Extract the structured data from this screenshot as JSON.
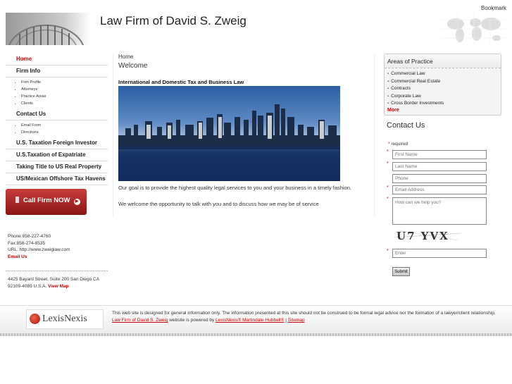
{
  "header": {
    "title": "Law Firm of David S. Zweig",
    "bookmark": "Bookmark"
  },
  "nav": {
    "home": "Home",
    "firm_info": "Firm Info",
    "firm_info_items": [
      "Firm Profile",
      "Attorneys",
      "Practice Areas",
      "Clients"
    ],
    "contact_us": "Contact Us",
    "contact_items": [
      "Email Form",
      "Directions"
    ],
    "taxation_foreign": "U.S. Taxation Foreign Investor",
    "taxation_expatriate": "U.S.Taxation of Expatriate",
    "taking_title": "Taking Title to US Real Property",
    "offshore": "US/Mexican Offshore Tax Havens"
  },
  "call_button": {
    "label": "Call Firm NOW"
  },
  "contact_info": {
    "phone": "Phone:858-227-4760",
    "fax": "Fax:858-274-8535",
    "url": "URL: http://www.zweiglaw.com",
    "email": "Email Us"
  },
  "address": {
    "text": "4425 Bayard Street, Suite 200 San Diego CA 92109-4089 U.S.A.",
    "view_map": "View Map"
  },
  "main": {
    "breadcrumb": "Home",
    "welcome": "Welcome",
    "heading": "International and Domestic Tax and Business Law",
    "para1": "Our goal is to provide the highest quality legal services to you and your business in a timely fashion.",
    "para2": "We welcome the opportunity to talk with you and to discuss how we may be of service"
  },
  "areas": {
    "title": "Areas of Practice",
    "items": [
      "Commercial Law",
      "Commercial Real Estate",
      "Contracts",
      "Corporate Law",
      "Cross Border Investments"
    ],
    "more": "More"
  },
  "contact_form": {
    "title": "Contact Us",
    "required_star": "*",
    "required_label": "required",
    "first_name": "First Name",
    "last_name": "Last Name",
    "phone": "Phone",
    "email": "Email Address",
    "message": "How can we help you?",
    "captcha_text": "U7 YVX",
    "enter": "Enter",
    "submit": "Submit"
  },
  "footer": {
    "logo": "LexisNexis",
    "text_main": "This web site is designed for general information only. The information presented at this site should not be construed to be formal legal advice nor the formation of a lawyer/client relationship.",
    "link_firm": "Law Firm of David S. Zweig",
    "text_mid": "website is powered by",
    "link_lexis": "LexisNexis® Martindale-Hubbell®",
    "separator": "|",
    "link_sitemap": "Sitemap"
  },
  "colors": {
    "accent": "#cc0000",
    "button": "#9e1e1e"
  }
}
